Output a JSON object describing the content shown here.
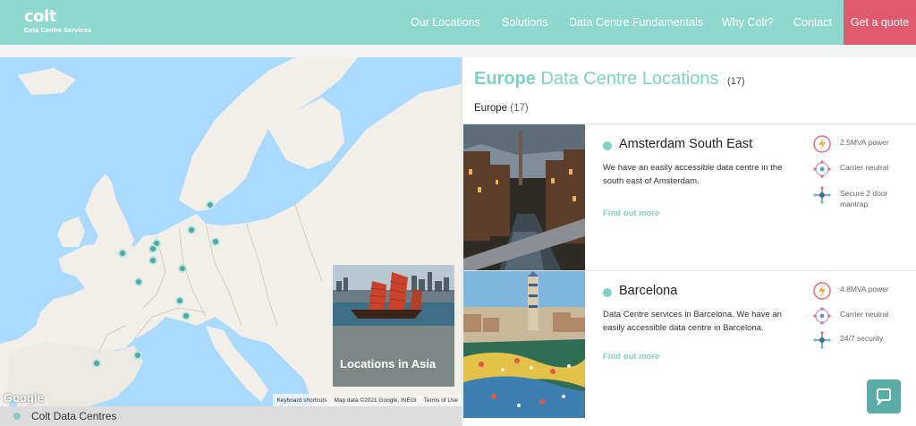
{
  "brand": {
    "name": "colt",
    "subtitle": "Data Centre Services"
  },
  "nav": {
    "items": [
      "Our Locations",
      "Solutions",
      "Data Centre Fundamentals",
      "Why Colt?",
      "Contact"
    ],
    "cta": "Get a quote"
  },
  "map": {
    "google": "Google",
    "attribution": [
      "Keyboard shortcuts",
      "Map data ©2021 Google, INEGI",
      "Terms of Use"
    ],
    "asia_card_label": "Locations in Asia",
    "legend_label": "Colt Data Centres",
    "marker_count": 15
  },
  "panel": {
    "title_accent": "Europe",
    "title_rest": "Data Centre Locations",
    "title_count": "(17)",
    "region_name": "Europe",
    "region_count": "(17)"
  },
  "locations": [
    {
      "name": "Amsterdam South East",
      "description": "We have an easily accessible data centre in the south east of Amsterdam.",
      "link": "Find out more",
      "features": [
        {
          "icon": "power-icon",
          "text": "2.5MVA power"
        },
        {
          "icon": "carrier-neutral-icon",
          "text": "Carrier neutral"
        },
        {
          "icon": "security-icon",
          "text": "Secure 2 door mantrap"
        }
      ]
    },
    {
      "name": "Barcelona",
      "description": "Data Centre services in Barcelona. We have an easily accessible data centre in Barcelona.",
      "link": "Find out more",
      "features": [
        {
          "icon": "power-icon",
          "text": "4.8MVA power"
        },
        {
          "icon": "carrier-neutral-icon",
          "text": "Carrier neutral"
        },
        {
          "icon": "security-icon",
          "text": "24/7 security"
        }
      ]
    }
  ],
  "colors": {
    "brand_teal": "#8ed9cb",
    "accent": "#7dd2c4",
    "cta": "#e05a6e",
    "marker": "#4ea7a0"
  },
  "chat": {
    "icon": "chat-bubble-icon"
  }
}
